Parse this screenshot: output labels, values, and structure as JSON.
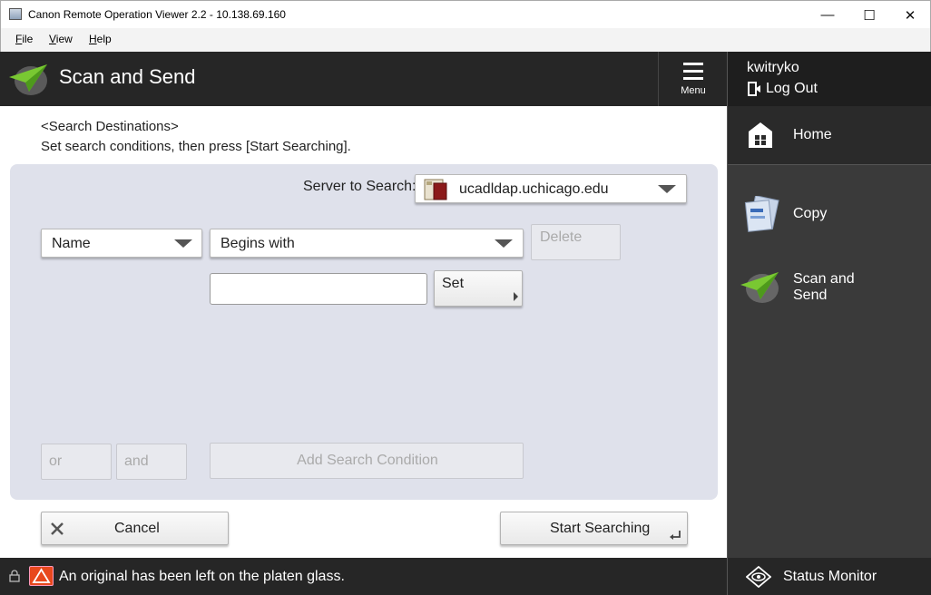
{
  "window": {
    "title": "Canon Remote Operation Viewer 2.2 - 10.138.69.160",
    "minimize": "—",
    "maximize": "☐",
    "close": "✕"
  },
  "menubar": {
    "file": "File",
    "view": "View",
    "help": "Help"
  },
  "header": {
    "title": "Scan and Send",
    "menu_label": "Menu"
  },
  "user": {
    "name": "kwitryko",
    "logout_label": "Log Out"
  },
  "sidebar": {
    "items": [
      {
        "label": "Home",
        "icon": "home-icon"
      },
      {
        "label": "Copy",
        "icon": "copy-icon"
      },
      {
        "label_line1": "Scan and",
        "label_line2": "Send",
        "icon": "scan-send-icon"
      }
    ],
    "status_monitor": "Status Monitor"
  },
  "content": {
    "instruction_heading": "<Search Destinations>",
    "instruction_text": "Set search conditions, then press [Start Searching].",
    "server_label": "Server to Search:",
    "server_value": "ucadldap.uchicago.edu",
    "condition_field": "Name",
    "condition_operator": "Begins with",
    "delete_label": "Delete",
    "set_label": "Set",
    "search_value": "",
    "or_label": "or",
    "and_label": "and",
    "add_condition_label": "Add Search Condition",
    "cancel_label": "Cancel",
    "start_label": "Start Searching"
  },
  "status": {
    "message": "An original has been left on the platen glass."
  },
  "colors": {
    "header_bg": "#262626",
    "panel_bg": "#dfe1eb",
    "sidebar_bg": "#3a3a3a",
    "accent_green": "#6cbf2a",
    "warning_red": "#e8481d"
  }
}
